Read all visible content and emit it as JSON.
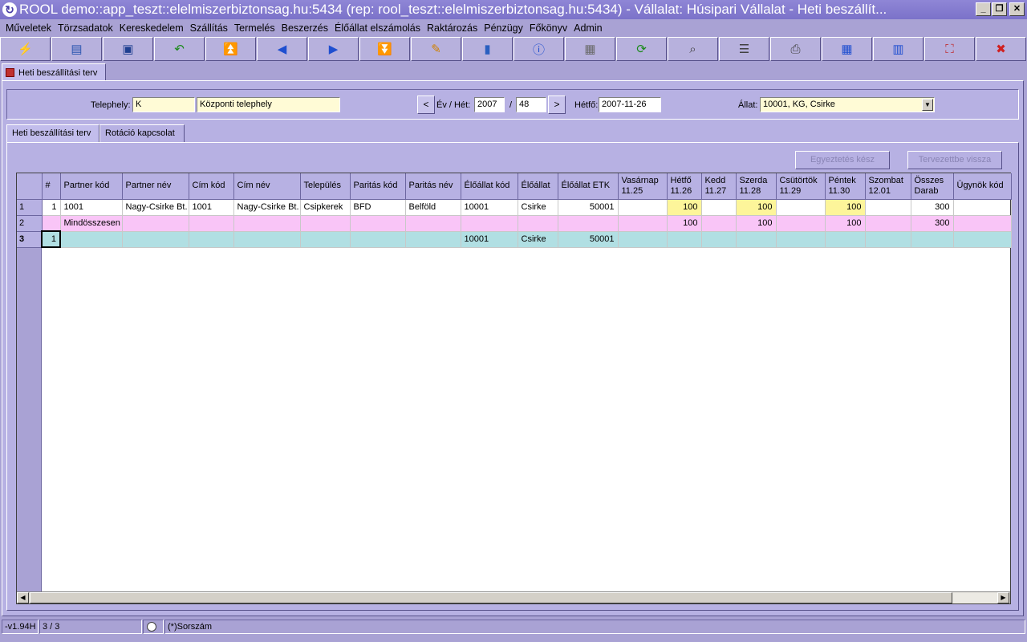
{
  "window": {
    "title": "ROOL demo::app_teszt::elelmiszerbiztonsag.hu:5434 (rep: rool_teszt::elelmiszerbiztonsag.hu:5434) - Vállalat: Húsipari Vállalat - Heti beszállít...",
    "app_icon_glyph": "↻",
    "minimize": "_",
    "restore": "❐",
    "close": "✕"
  },
  "menu": [
    "Műveletek",
    "Törzsadatok",
    "Kereskedelem",
    "Szállítás",
    "Termelés",
    "Beszerzés",
    "Élőállat elszámolás",
    "Raktározás",
    "Pénzügy",
    "Főkönyv",
    "Admin"
  ],
  "toolbar": [
    {
      "name": "lightning-icon",
      "glyph": "⚡",
      "color": "#c07a00"
    },
    {
      "name": "open-folder-icon",
      "glyph": "▤",
      "color": "#2a55b0"
    },
    {
      "name": "save-icon",
      "glyph": "▣",
      "color": "#1f3f90"
    },
    {
      "name": "undo-arrow-icon",
      "glyph": "↶",
      "color": "#1b8a1b"
    },
    {
      "name": "first-record-icon",
      "glyph": "⏫",
      "color": "#1f4fd0"
    },
    {
      "name": "previous-record-icon",
      "glyph": "◀",
      "color": "#1f4fd0"
    },
    {
      "name": "next-record-icon",
      "glyph": "▶",
      "color": "#1f4fd0"
    },
    {
      "name": "last-record-icon",
      "glyph": "⏬",
      "color": "#1f4fd0"
    },
    {
      "name": "edit-pencil-icon",
      "glyph": "✎",
      "color": "#d08000"
    },
    {
      "name": "database-icon",
      "glyph": "▮",
      "color": "#2a5fc0"
    },
    {
      "name": "info-icon",
      "glyph": "ⓘ",
      "color": "#1f4fd0"
    },
    {
      "name": "form-view-icon",
      "glyph": "▦",
      "color": "#6a6a6a"
    },
    {
      "name": "refresh-icon",
      "glyph": "⟳",
      "color": "#1b8a1b"
    },
    {
      "name": "search-icon",
      "glyph": "⌕",
      "color": "#404040"
    },
    {
      "name": "rows-icon",
      "glyph": "☰",
      "color": "#404040"
    },
    {
      "name": "print-icon",
      "glyph": "⎙",
      "color": "#404040"
    },
    {
      "name": "grid-export-icon",
      "glyph": "▦",
      "color": "#1f4fd0"
    },
    {
      "name": "grid-import-icon",
      "glyph": "▥",
      "color": "#1f4fd0"
    },
    {
      "name": "fullscreen-icon",
      "glyph": "⛶",
      "color": "#c02020"
    },
    {
      "name": "exit-icon",
      "glyph": "✖",
      "color": "#d02020"
    }
  ],
  "doc_tab": {
    "label": "Heti beszállítási terv"
  },
  "filters": {
    "telephely_label": "Telephely:",
    "telephely_code": "K",
    "telephely_name": "Központi telephely",
    "prev": "<",
    "ev_het_label": "Év / Hét:",
    "year": "2007",
    "slash": "/",
    "week": "48",
    "next": ">",
    "hetfo_label": "Hétfő:",
    "hetfo": "2007-11-26",
    "allat_label": "Állat:",
    "allat": "10001, KG, Csirke",
    "allat_dd": "▼"
  },
  "tabs": {
    "tab1": "Heti beszállítási terv",
    "tab2": "Rotáció kapcsolat"
  },
  "buttons": {
    "egyeztetes": "Egyeztetés kész",
    "tervezettbe": "Tervezettbe vissza"
  },
  "grid": {
    "columns": [
      "#",
      "Partner kód",
      "Partner név",
      "Cím kód",
      "Cím név",
      "Település",
      "Paritás kód",
      "Paritás név",
      "Élőállat kód",
      "Élőállat",
      "Élőállat ETK",
      "Vasárnap 11.25",
      "Hétfő 11.26",
      "Kedd 11.27",
      "Szerda 11.28",
      "Csütörtök 11.29",
      "Péntek 11.30",
      "Szombat 12.01",
      "Összes Darab",
      "Ügynök kód"
    ],
    "rows": [
      {
        "rh": "1",
        "cells": [
          "1",
          "1001",
          "Nagy-Csirke Bt.",
          "1001",
          "Nagy-Csirke Bt.",
          "Csipkerek",
          "BFD",
          "Belföld",
          "10001",
          "Csirke",
          "50001",
          "",
          "100",
          "",
          "100",
          "",
          "100",
          "",
          "300",
          ""
        ]
      },
      {
        "rh": "2",
        "cells": [
          "",
          "Mindösszesen",
          "",
          "",
          "",
          "",
          "",
          "",
          "",
          "",
          "",
          "",
          "100",
          "",
          "100",
          "",
          "100",
          "",
          "300",
          ""
        ]
      },
      {
        "rh": "3",
        "cells": [
          "1",
          "",
          "",
          "",
          "",
          "",
          "",
          "",
          "10001",
          "Csirke",
          "50001",
          "",
          "",
          "",
          "",
          "",
          "",
          "",
          "",
          ""
        ]
      }
    ]
  },
  "status": {
    "version": "-v1.94H",
    "records": "3 / 3",
    "sorszam": "(*)Sorszám"
  }
}
